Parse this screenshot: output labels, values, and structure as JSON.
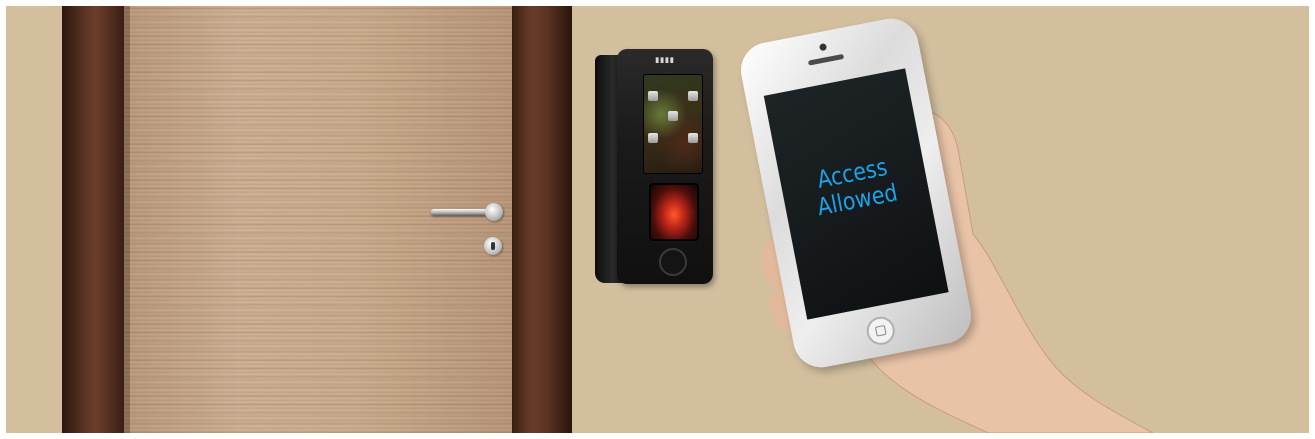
{
  "scene": {
    "background_color": "#d3bf9e",
    "door_color": "#c8aa8c",
    "frame_color": "#4a2a1c"
  },
  "phone": {
    "screen_message": [
      "Access",
      "Allowed"
    ],
    "message_color": "#1aa3e8"
  }
}
